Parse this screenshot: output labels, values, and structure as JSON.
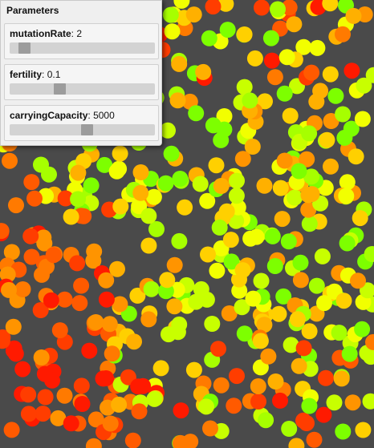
{
  "panel": {
    "title": "Parameters",
    "params": [
      {
        "name": "mutationRate",
        "value": "2",
        "slider_fraction": 0.1
      },
      {
        "name": "fertility",
        "value": "0.1",
        "slider_fraction": 0.34
      },
      {
        "name": "carryingCapacity",
        "value": "5000",
        "slider_fraction": 0.53
      }
    ]
  },
  "colors": {
    "background": "#4a4a4a",
    "organism_palette": [
      "#ff1a00",
      "#ff3d00",
      "#ff5a00",
      "#ff7a00",
      "#ff9400",
      "#ffb000",
      "#ffd000",
      "#f2ff00",
      "#c8ff00",
      "#a6ff00",
      "#7dff00"
    ]
  }
}
